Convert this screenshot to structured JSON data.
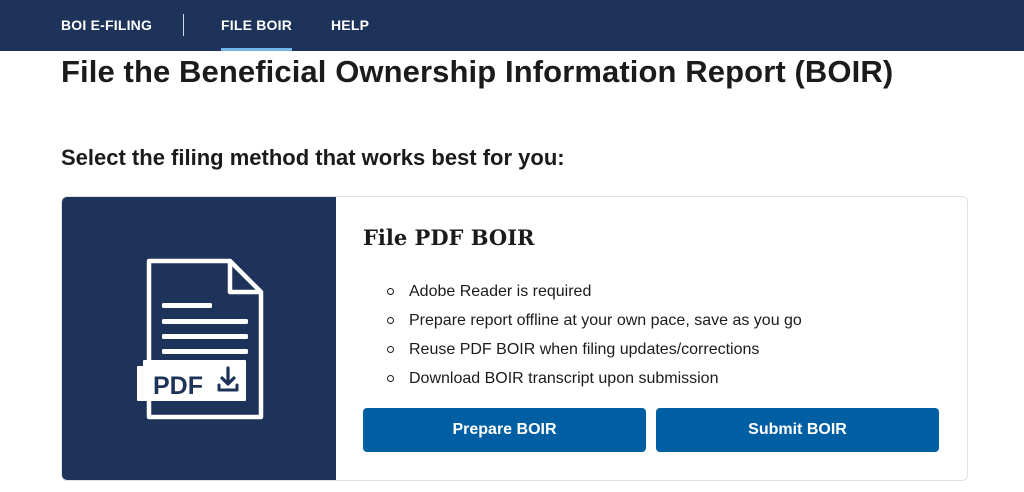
{
  "nav": {
    "items": [
      {
        "label": "BOI E-FILING"
      },
      {
        "label": "FILE BOIR"
      },
      {
        "label": "HELP"
      }
    ]
  },
  "page": {
    "title": "File the Beneficial Ownership Information Report (BOIR)",
    "subtitle": "Select the filing method that works best for you:"
  },
  "card": {
    "title": "File PDF BOIR",
    "icon_label": "PDF",
    "bullets": [
      "Adobe Reader is required",
      "Prepare report offline at your own pace, save as you go",
      "Reuse PDF BOIR when filing updates/corrections",
      "Download BOIR transcript upon submission"
    ],
    "buttons": {
      "prepare": "Prepare BOIR",
      "submit": "Submit BOIR"
    }
  },
  "colors": {
    "nav_bg": "#1e3359",
    "nav_active_underline": "#73b3e7",
    "button_bg": "#005ea2",
    "media_bg": "#1e3359"
  }
}
